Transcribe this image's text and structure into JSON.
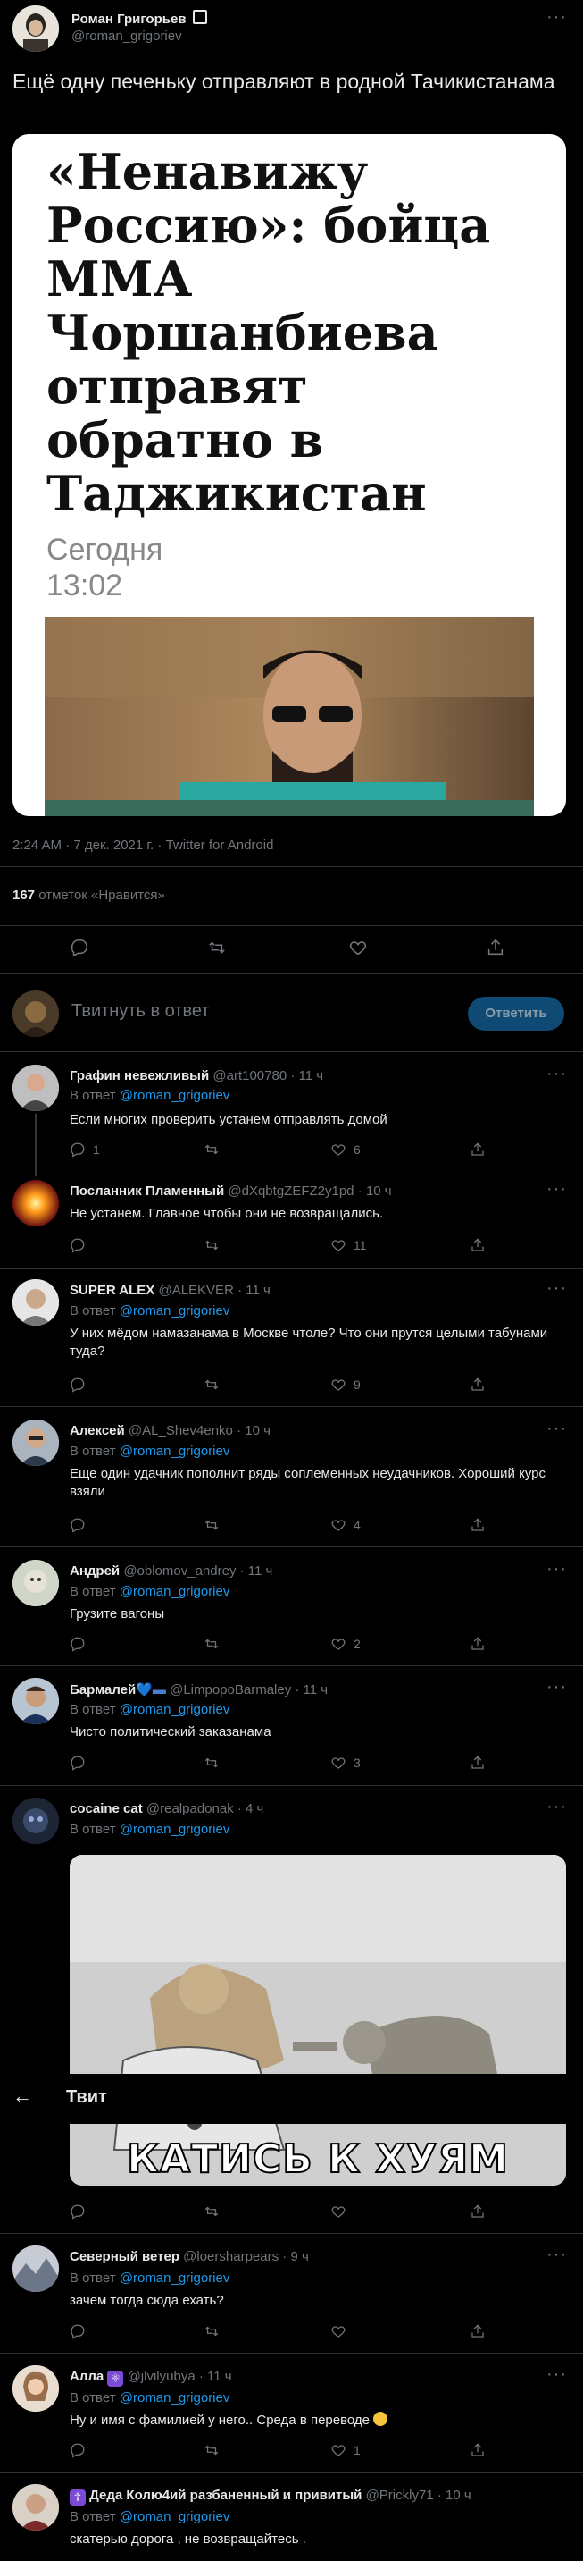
{
  "main_tweet": {
    "author_name": "Роман Григорьев",
    "author_handle": "@roman_grigoriev",
    "text": "Ещё одну печеньку отправляют в родной Тачикистанама",
    "card": {
      "headline": "«Ненавижу Россию»: бойца ММА Чоршанбиева отправят обратно в Таджикистан",
      "date_line1": "Сегодня",
      "date_line2": "13:02"
    },
    "meta": "2:24 AM · 7 дек. 2021 г. · Twitter for Android",
    "likes_count": "167",
    "likes_label": "отметок «Нравится»"
  },
  "reply_box": {
    "placeholder": "Твитнуть в ответ",
    "button": "Ответить"
  },
  "header": {
    "title": "Твит",
    "back_icon": "arrow-left-icon"
  },
  "replying_prefix": "В ответ",
  "replies": [
    {
      "name": "Графин невежливый",
      "handle": "@art100780",
      "time": "· 11 ч",
      "replying_to": "@roman_grigoriev",
      "text": "Если многих проверить устанем отправлять домой",
      "replies": "1",
      "likes": "6"
    },
    {
      "name": "Посланник Пламенный",
      "handle": "@dXqbtgZEFZ2y1pd",
      "time": "· 10 ч",
      "text": "Не устанем. Главное чтобы они не возвращались.",
      "likes": "11"
    },
    {
      "name": "SUPER ALEX",
      "handle": "@ALEKVER",
      "time": "· 11 ч",
      "replying_to": "@roman_grigoriev",
      "text": "У них мёдом намазанама в Москве чтоле? Что они прутся целыми табунами туда?",
      "likes": "9"
    },
    {
      "name": "Алексей",
      "handle": "@AL_Shev4enko",
      "time": "· 10 ч",
      "replying_to": "@roman_grigoriev",
      "text": "Еще один удачник пополнит ряды соплеменных неудачников. Хороший курс взяли",
      "likes": "4"
    },
    {
      "name": "Андрей",
      "handle": "@oblomov_andrey",
      "time": "· 11 ч",
      "replying_to": "@roman_grigoriev",
      "text": "Грузите вагоны",
      "likes": "2"
    },
    {
      "name": "Бармалей",
      "handle": "@LimpopoBarmaley",
      "time": "· 11 ч",
      "replying_to": "@roman_grigoriev",
      "text": "Чисто политический заказанама",
      "likes": "3"
    },
    {
      "name": "cocaine cat",
      "handle": "@realpadonak",
      "time": "· 4 ч",
      "replying_to": "@roman_grigoriev",
      "image_caption": "КАТИСЬ К ХУЯМ"
    },
    {
      "name": "Северный ветер",
      "handle": "@loersharpears",
      "time": "· 9 ч",
      "replying_to": "@roman_grigoriev",
      "text": "зачем тогда сюда ехать?"
    },
    {
      "name": "Алла",
      "handle": "@jlvilyubya",
      "time": "· 11 ч",
      "replying_to": "@roman_grigoriev",
      "text": "Ну и имя с фамилией у него.. Среда в переводе",
      "likes": "1"
    },
    {
      "name": "Деда Колю4ий разбаненный и привитый",
      "handle": "@Prickly71",
      "time": "· 10 ч",
      "replying_to": "@roman_grigoriev",
      "text": "скатерью дорога , не возвращайтесь ."
    }
  ],
  "colors": {
    "background": "#000000",
    "accent": "#1d9bf0",
    "muted": "#71767b",
    "divider": "#2f3336",
    "reply_button_bg": "#0e4a73"
  }
}
